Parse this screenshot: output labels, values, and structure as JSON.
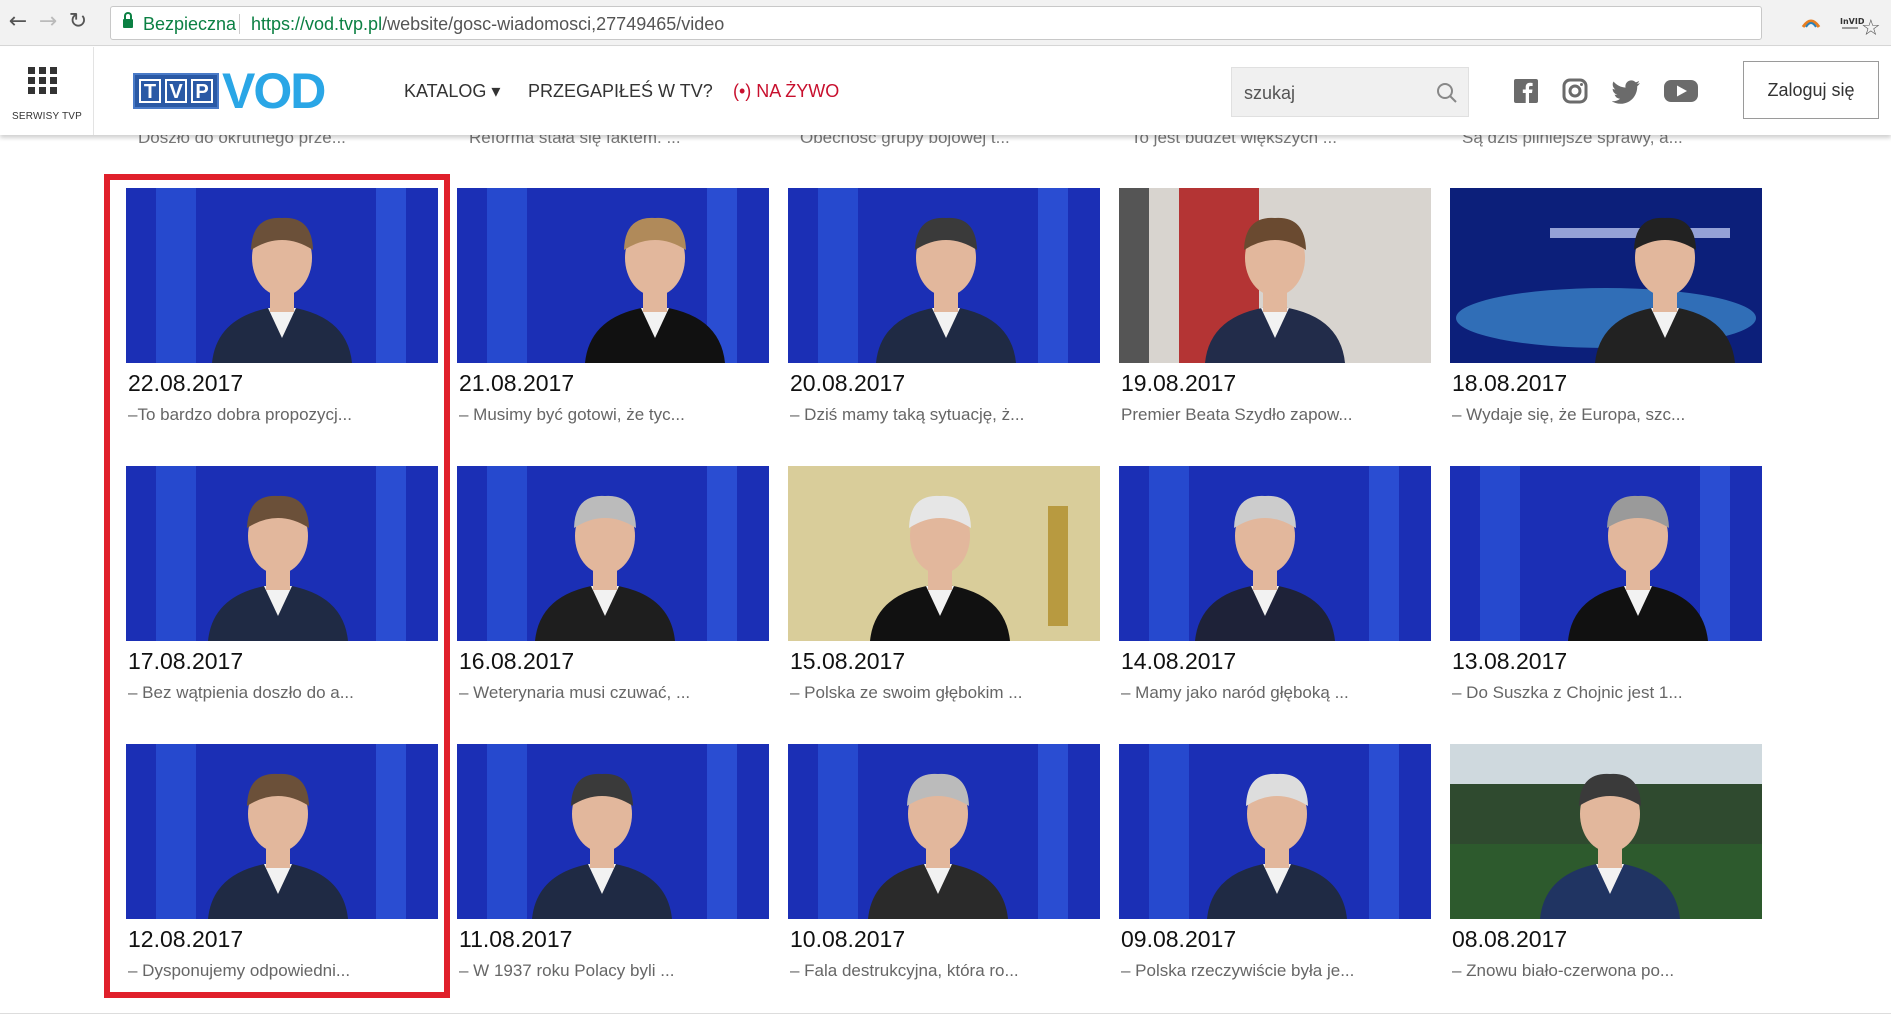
{
  "browser": {
    "secure_label": "Bezpieczna",
    "url_host": "https://vod.tvp.pl",
    "url_path": "/website/gosc-wiadomosci,27749465/video"
  },
  "header": {
    "services_label": "SERWISY TVP",
    "logo_letters": [
      "T",
      "V",
      "P"
    ],
    "vod_label": "VOD",
    "menu": [
      {
        "label": "KATALOG ▾"
      },
      {
        "label": "PRZEGAPIŁEŚ W TV?"
      },
      {
        "label": "(•) NA ŻYWO"
      }
    ],
    "search_placeholder": "szukaj",
    "login_label": "Zaloguj się",
    "social_icons": [
      "facebook-icon",
      "instagram-icon",
      "twitter-icon",
      "youtube-icon"
    ]
  },
  "clipped_descriptions": [
    "Doszło do okrutnego prze...",
    "Reforma stała się faktem. ...",
    "Obecność grupy bojowej t...",
    "To jest budżet większych ...",
    "Są dziś pilniejsze sprawy, a..."
  ],
  "videos": [
    {
      "date": "22.08.2017",
      "desc": "–To bardzo dobra propozycj...",
      "bg": "#1b2fb5",
      "scene": "studio"
    },
    {
      "date": "21.08.2017",
      "desc": "– Musimy być gotowi, że tyc...",
      "bg": "#1b2fb5",
      "scene": "studio"
    },
    {
      "date": "20.08.2017",
      "desc": "– Dziś mamy taką sytuację, ż...",
      "bg": "#1b2fb5",
      "scene": "studio"
    },
    {
      "date": "19.08.2017",
      "desc": "Premier Beata Szydło zapow...",
      "bg": "#b43434",
      "scene": "office"
    },
    {
      "date": "18.08.2017",
      "desc": "– Wydaje się, że Europa, szc...",
      "bg": "#102a9a",
      "scene": "wide"
    },
    {
      "date": "17.08.2017",
      "desc": "– Bez wątpienia doszło do a...",
      "bg": "#1b2fb5",
      "scene": "studio"
    },
    {
      "date": "16.08.2017",
      "desc": "– Weterynaria musi czuwać, ...",
      "bg": "#1b2fb5",
      "scene": "studio"
    },
    {
      "date": "15.08.2017",
      "desc": "– Polska ze swoim głębokim ...",
      "bg": "#d9cd9a",
      "scene": "church"
    },
    {
      "date": "14.08.2017",
      "desc": "– Mamy jako naród głęboką ...",
      "bg": "#1b2fb5",
      "scene": "studio"
    },
    {
      "date": "13.08.2017",
      "desc": "– Do Suszka z Chojnic jest 1...",
      "bg": "#1b2fb5",
      "scene": "studio"
    },
    {
      "date": "12.08.2017",
      "desc": "– Dysponujemy odpowiedni...",
      "bg": "#1b2fb5",
      "scene": "studio"
    },
    {
      "date": "11.08.2017",
      "desc": "– W 1937 roku Polacy byli ...",
      "bg": "#1b2fb5",
      "scene": "studio"
    },
    {
      "date": "10.08.2017",
      "desc": "– Fala destrukcyjna, która ro...",
      "bg": "#1b2fb5",
      "scene": "studio"
    },
    {
      "date": "09.08.2017",
      "desc": "– Polska rzeczywiście była je...",
      "bg": "#1b2fb5",
      "scene": "studio"
    },
    {
      "date": "08.08.2017",
      "desc": "– Znowu biało-czerwona po...",
      "bg": "#3a5a3a",
      "scene": "outdoor"
    }
  ],
  "colors": {
    "accent_red": "#e0202b",
    "tvp_blue": "#2a59a5",
    "vod_blue": "#2aa6e6",
    "secure_green": "#0b8043"
  }
}
